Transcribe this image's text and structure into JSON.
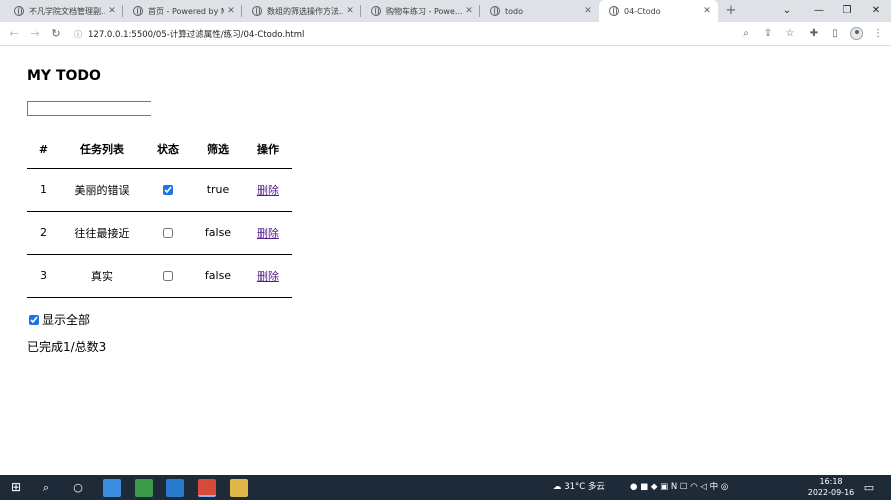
{
  "browser": {
    "tabs": [
      {
        "title": "不凡学院文档管理副…"
      },
      {
        "title": "首页 - Powered by M…"
      },
      {
        "title": "数组的筛选操作方法…"
      },
      {
        "title": "购物车练习 - Powe…"
      },
      {
        "title": "todo"
      },
      {
        "title": "04-Ctodo"
      }
    ],
    "new_tab_label": "+",
    "url": "127.0.0.1:5500/05-计算过滤属性/练习/04-Ctodo.html"
  },
  "app": {
    "title": "MY TODO",
    "input_value": "",
    "table": {
      "headers": [
        "#",
        "任务列表",
        "状态",
        "筛选",
        "操作"
      ],
      "rows": [
        {
          "num": "1",
          "name": "美丽的错误",
          "done": true,
          "filter": "true",
          "action": "删除"
        },
        {
          "num": "2",
          "name": "往往最接近",
          "done": false,
          "filter": "false",
          "action": "删除"
        },
        {
          "num": "3",
          "name": "真实",
          "done": false,
          "filter": "false",
          "action": "删除"
        }
      ]
    },
    "show_all": {
      "checked": true,
      "label": "显示全部"
    },
    "summary": "已完成1/总数3"
  },
  "taskbar": {
    "weather": "31°C 多云",
    "ime": "中",
    "time": "16:18",
    "date": "2022-09-16"
  },
  "colors": {
    "tabstrip": "#dee1e6",
    "link_visited": "#551a8b",
    "checkbox_accent": "#1a73e8",
    "taskbar": "#1f2a38"
  }
}
